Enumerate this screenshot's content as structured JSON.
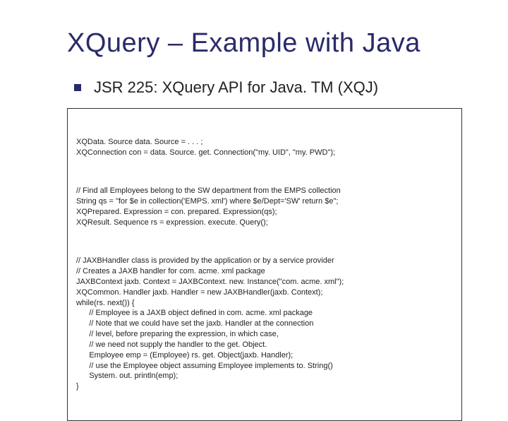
{
  "slide": {
    "title": "XQuery – Example with Java",
    "subtitle": "JSR 225: XQuery API for Java. TM (XQJ)",
    "code": {
      "block1": "XQData. Source data. Source = . . . ;\nXQConnection con = data. Source. get. Connection(\"my. UID\", \"my. PWD\");",
      "block2": "// Find all Employees belong to the SW department from the EMPS collection\nString qs = \"for $e in collection('EMPS. xml') where $e/Dept='SW' return $e\";\nXQPrepared. Expression = con. prepared. Expression(qs);\nXQResult. Sequence rs = expression. execute. Query();",
      "block3": "// JAXBHandler class is provided by the application or by a service provider\n// Creates a JAXB handler for com. acme. xml package\nJAXBContext jaxb. Context = JAXBContext. new. Instance(\"com. acme. xml\");\nXQCommon. Handler jaxb. Handler = new JAXBHandler(jaxb. Context);\nwhile(rs. next()) {\n      // Employee is a JAXB object defined in com. acme. xml package\n      // Note that we could have set the jaxb. Handler at the connection\n      // level, before preparing the expression, in which case,\n      // we need not supply the handler to the get. Object.\n      Employee emp = (Employee) rs. get. Object(jaxb. Handler);\n      // use the Employee object assuming Employee implements to. String()\n      System. out. println(emp);\n}"
    }
  }
}
